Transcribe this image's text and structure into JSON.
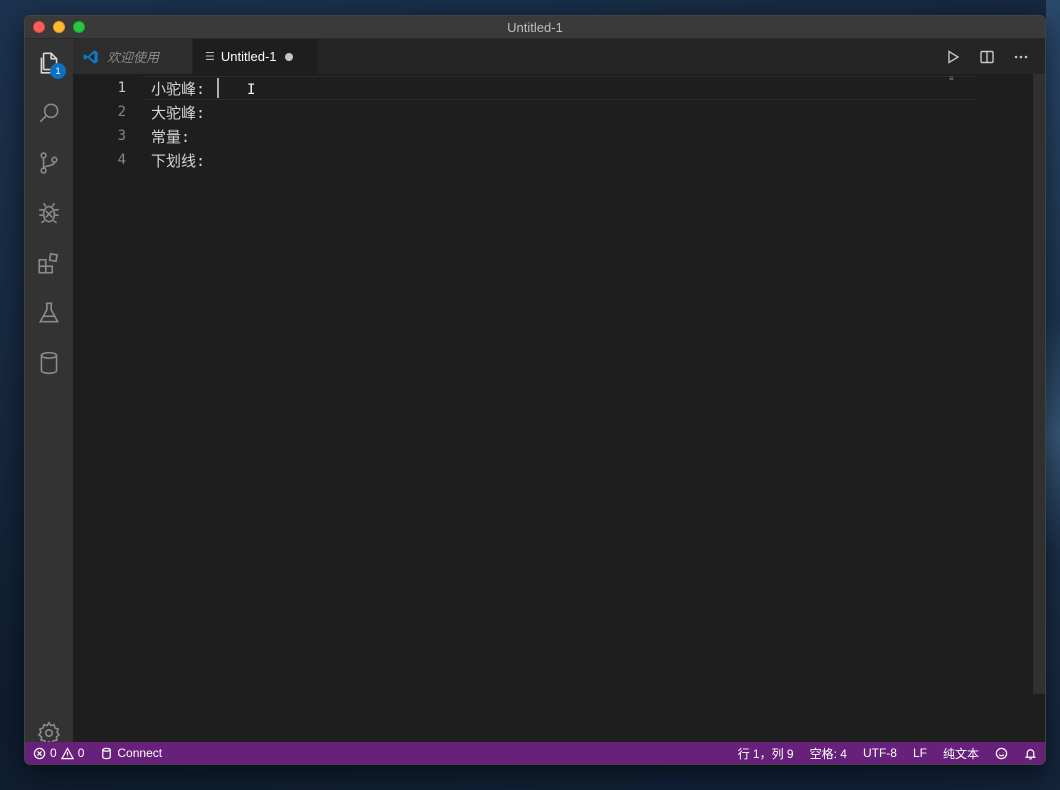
{
  "window": {
    "title": "Untitled-1"
  },
  "activity_bar": {
    "explorer_badge": "1",
    "items": [
      "files-icon",
      "search-icon",
      "source-control-icon",
      "debug-icon",
      "extensions-icon",
      "testing-icon",
      "database-icon"
    ],
    "bottom": "gear-icon"
  },
  "tabs": [
    {
      "label": "欢迎使用",
      "icon": "vscode-logo-icon",
      "active": false
    },
    {
      "label": "Untitled-1",
      "icon": "file-lines-icon",
      "active": true,
      "dirty": true
    }
  ],
  "editor": {
    "lines": [
      {
        "number": "1",
        "text": "小驼峰:"
      },
      {
        "number": "2",
        "text": "大驼峰:"
      },
      {
        "number": "3",
        "text": "常量:"
      },
      {
        "number": "4",
        "text": "下划线:"
      }
    ],
    "mouse_cursor": "I"
  },
  "status_bar": {
    "errors": "0",
    "warnings": "0",
    "connect": "Connect",
    "position": "行 1，列 9",
    "spaces": "空格: 4",
    "encoding": "UTF-8",
    "eol": "LF",
    "language": "纯文本"
  },
  "colors": {
    "status_bar_bg": "#68217a",
    "editor_bg": "#1e1e1e",
    "activity_bar_bg": "#333333",
    "badge": "#0e70c0"
  }
}
